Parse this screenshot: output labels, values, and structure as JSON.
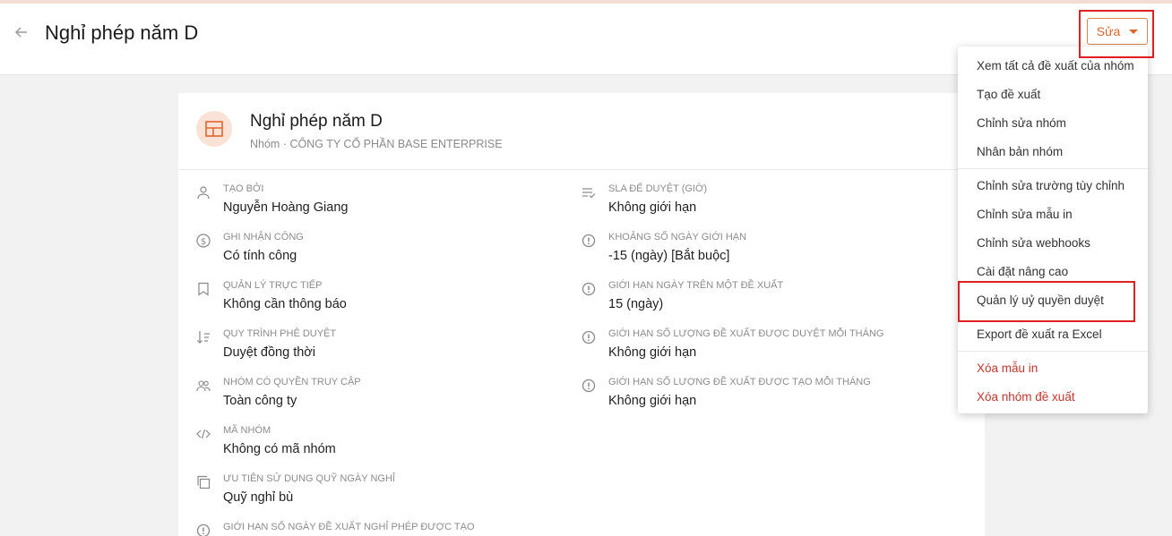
{
  "header": {
    "back_icon": "arrow-left-icon",
    "title": "Nghỉ phép năm D",
    "edit_label": "Sửa"
  },
  "card": {
    "title": "Nghỉ phép năm D",
    "subtitle": "Nhóm · CÔNG TY CỔ PHẦN BASE ENTERPRISE",
    "badge_icon": "layout-icon",
    "left_fields": [
      {
        "icon": "user-icon",
        "label": "TẠO BỞI",
        "value": "Nguyễn Hoàng Giang"
      },
      {
        "icon": "dollar-icon",
        "label": "GHI NHẬN CÔNG",
        "value": "Có tính công"
      },
      {
        "icon": "bookmark-icon",
        "label": "QUẢN LÝ TRỰC TIẾP",
        "value": "Không cần thông báo"
      },
      {
        "icon": "sort-icon",
        "label": "QUY TRÌNH PHÊ DUYỆT",
        "value": "Duyệt đồng thời"
      },
      {
        "icon": "users-icon",
        "label": "NHÓM CÓ QUYỀN TRUY CẬP",
        "value": "Toàn công ty"
      },
      {
        "icon": "code-icon",
        "label": "MÃ NHÓM",
        "value": "Không có mã nhóm"
      },
      {
        "icon": "copy-icon",
        "label": "ƯU TIÊN SỬ DỤNG QUỸ NGÀY NGHỈ",
        "value": "Quỹ nghỉ bù"
      },
      {
        "icon": "alert-icon",
        "label": "GIỚI HẠN SỐ NGÀY ĐỀ XUẤT NGHỈ PHÉP ĐƯỢC TẠO",
        "value": ""
      }
    ],
    "right_fields": [
      {
        "icon": "checklist-icon",
        "label": "SLA ĐỂ DUYỆT (GIỜ)",
        "value": "Không giới hạn"
      },
      {
        "icon": "alert-icon",
        "label": "KHOẢNG SỐ NGÀY GIỚI HẠN",
        "value": "-15 (ngày) [Bắt buộc]"
      },
      {
        "icon": "alert-icon",
        "label": "GIỚI HẠN NGÀY TRÊN MỘT ĐỀ XUẤT",
        "value": "15 (ngày)"
      },
      {
        "icon": "alert-icon",
        "label": "GIỚI HẠN SỐ LƯỢNG ĐỀ XUẤT ĐƯỢC DUYỆT MỖI THÁNG",
        "value": "Không giới hạn"
      },
      {
        "icon": "alert-icon",
        "label": "GIỚI HẠN SỐ LƯỢNG ĐỀ XUẤT ĐƯỢC TẠO MỖI THÁNG",
        "value": "Không giới hạn"
      }
    ]
  },
  "menu": {
    "items": [
      "Xem tất cả đề xuất của nhóm",
      "Tạo đề xuất",
      "Chỉnh sửa nhóm",
      "Nhân bản nhóm",
      "Chỉnh sửa trường tùy chỉnh",
      "Chỉnh sửa mẫu in",
      "Chỉnh sửa webhooks",
      "Cài đặt nâng cao",
      "Quản lý uỷ quyền duyệt",
      "Export đề xuất ra Excel",
      "Xóa mẫu in",
      "Xóa nhóm đề xuất"
    ]
  },
  "colors": {
    "accent": "#d9672d",
    "danger": "#c0362c",
    "highlight": "#e02020"
  }
}
